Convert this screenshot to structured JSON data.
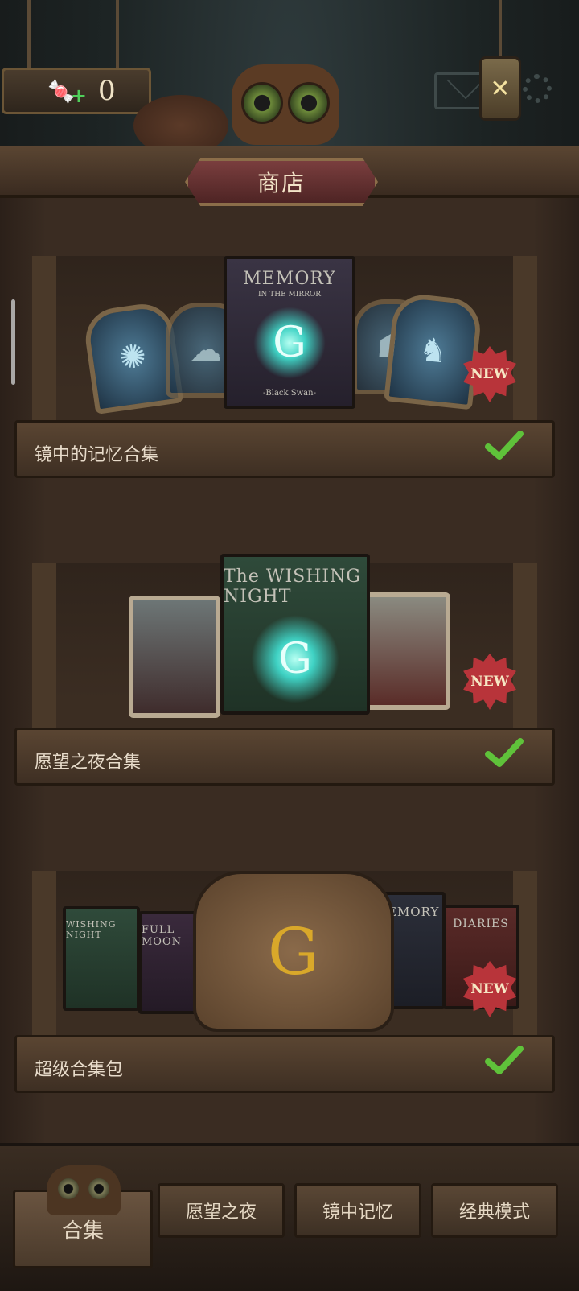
{
  "header": {
    "candy_count": "0",
    "candy_icon": "candy-plus-icon",
    "title": "商店"
  },
  "shelves": [
    {
      "label": "镜中的记忆合集",
      "badge": "NEW",
      "book_title": "MEMORY",
      "book_subtitle": "IN THE MIRROR",
      "book_footer": "-Black Swan-"
    },
    {
      "label": "愿望之夜合集",
      "badge": "NEW",
      "book_title": "The WISHING NIGHT",
      "book_subtitle": "",
      "book_footer": ""
    },
    {
      "label": "超级合集包",
      "badge": "NEW",
      "book_titles": [
        "WISHING NIGHT",
        "FULL MOON",
        "MEMORY",
        "DIARIES"
      ]
    }
  ],
  "nav": {
    "collection": "合集",
    "wishing_night": "愿望之夜",
    "mirror_memory": "镜中记忆",
    "classic_mode": "经典模式"
  },
  "colors": {
    "wood": "#3a2c22",
    "badge_red": "#b8343a",
    "check_green": "#5fc23a",
    "title_plate": "#6a3333"
  }
}
